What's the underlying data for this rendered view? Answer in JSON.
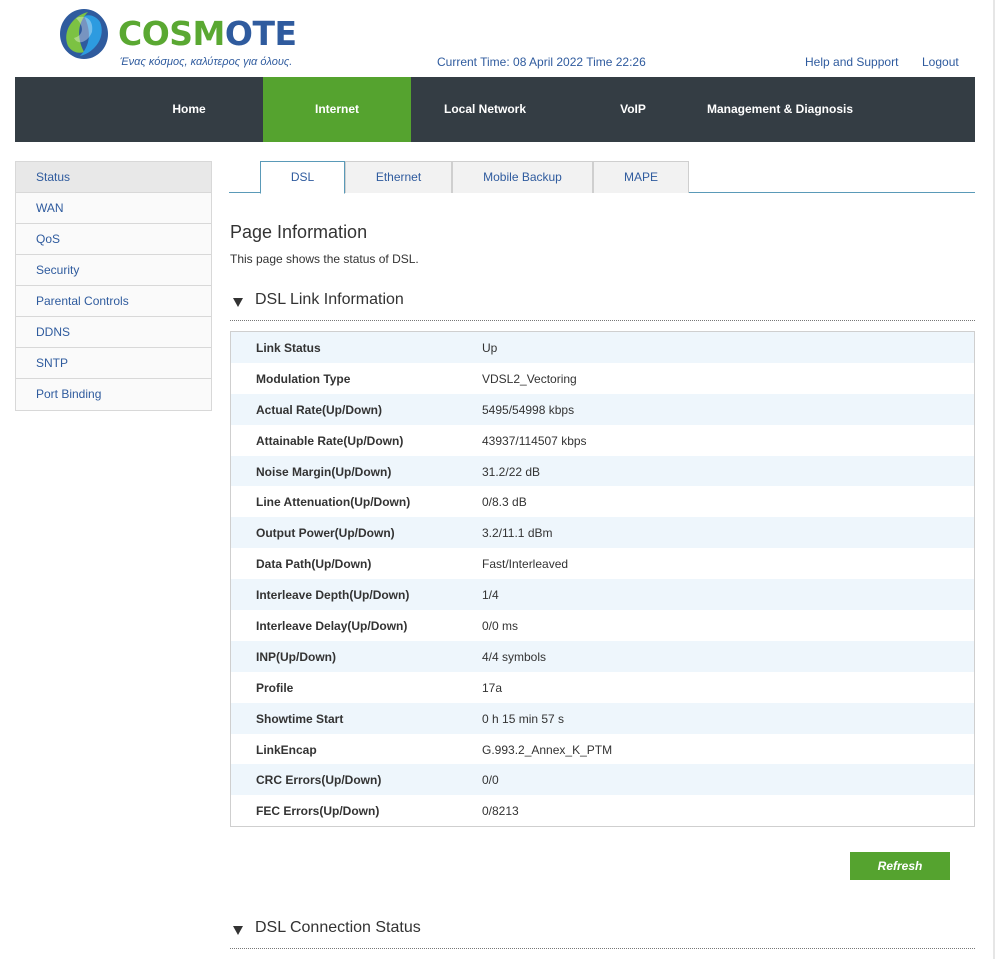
{
  "brand": {
    "name_part1": "COSM",
    "name_part2": "OTE",
    "tagline": "Ένας κόσμος, καλύτερος για όλους.",
    "colors": {
      "green": "#55a32f",
      "blue": "#2f5b9e",
      "nav_bg": "#343d44"
    }
  },
  "header": {
    "current_time": "Current Time: 08 April 2022 Time 22:26",
    "help_link": "Help and Support",
    "logout_link": "Logout"
  },
  "nav": {
    "items": [
      {
        "label": "Home",
        "active": false
      },
      {
        "label": "Internet",
        "active": true
      },
      {
        "label": "Local Network",
        "active": false
      },
      {
        "label": "VoIP",
        "active": false
      },
      {
        "label": "Management & Diagnosis",
        "active": false
      }
    ]
  },
  "sidebar": {
    "items": [
      {
        "label": "Status",
        "active": true
      },
      {
        "label": "WAN",
        "active": false
      },
      {
        "label": "QoS",
        "active": false
      },
      {
        "label": "Security",
        "active": false
      },
      {
        "label": "Parental Controls",
        "active": false
      },
      {
        "label": "DDNS",
        "active": false
      },
      {
        "label": "SNTP",
        "active": false
      },
      {
        "label": "Port Binding",
        "active": false
      }
    ]
  },
  "tabs": [
    {
      "label": "DSL",
      "active": true
    },
    {
      "label": "Ethernet",
      "active": false
    },
    {
      "label": "Mobile Backup",
      "active": false
    },
    {
      "label": "MAPE",
      "active": false
    }
  ],
  "page": {
    "title": "Page Information",
    "description": "This page shows the status of DSL."
  },
  "dsl_link": {
    "heading": "DSL Link Information",
    "rows": [
      {
        "key": "Link Status",
        "value": "Up"
      },
      {
        "key": "Modulation Type",
        "value": "VDSL2_Vectoring"
      },
      {
        "key": "Actual Rate(Up/Down)",
        "value": "5495/54998 kbps"
      },
      {
        "key": "Attainable Rate(Up/Down)",
        "value": "43937/114507 kbps"
      },
      {
        "key": "Noise Margin(Up/Down)",
        "value": "31.2/22 dB"
      },
      {
        "key": "Line Attenuation(Up/Down)",
        "value": "0/8.3 dB"
      },
      {
        "key": "Output Power(Up/Down)",
        "value": "3.2/11.1 dBm"
      },
      {
        "key": "Data Path(Up/Down)",
        "value": "Fast/Interleaved"
      },
      {
        "key": "Interleave Depth(Up/Down)",
        "value": "1/4"
      },
      {
        "key": "Interleave Delay(Up/Down)",
        "value": "0/0 ms"
      },
      {
        "key": "INP(Up/Down)",
        "value": "4/4 symbols"
      },
      {
        "key": "Profile",
        "value": "17a"
      },
      {
        "key": "Showtime Start",
        "value": "0 h 15 min 57 s"
      },
      {
        "key": "LinkEncap",
        "value": "G.993.2_Annex_K_PTM"
      },
      {
        "key": "CRC Errors(Up/Down)",
        "value": "0/0"
      },
      {
        "key": "FEC Errors(Up/Down)",
        "value": "0/8213"
      }
    ]
  },
  "refresh_label": "Refresh",
  "dsl_connection": {
    "heading": "DSL Connection Status"
  }
}
